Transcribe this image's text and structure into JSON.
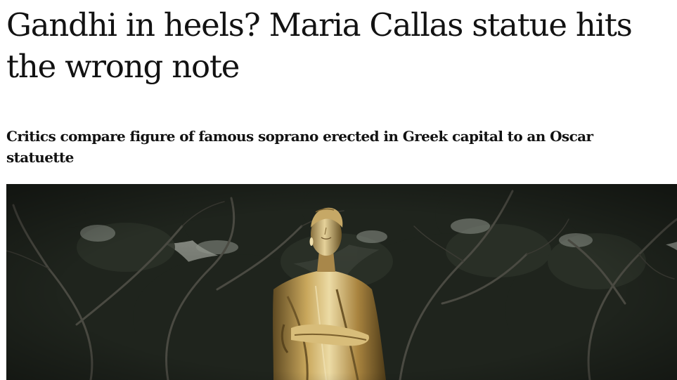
{
  "article": {
    "headline": "Gandhi in heels? Maria Callas statue hits the wrong note",
    "standfirst": "Critics compare figure of famous soprano erected in Greek capital to an Oscar statuette"
  },
  "photo": {
    "subject": "statue-of-maria-callas",
    "colors": {
      "sky": "#8a8f86",
      "foliage": "#1f241d",
      "branch": "#3b3a33",
      "statue_gold": "#b8954d",
      "statue_highlight": "#e8d6a0",
      "statue_shadow": "#5f4a22"
    }
  }
}
